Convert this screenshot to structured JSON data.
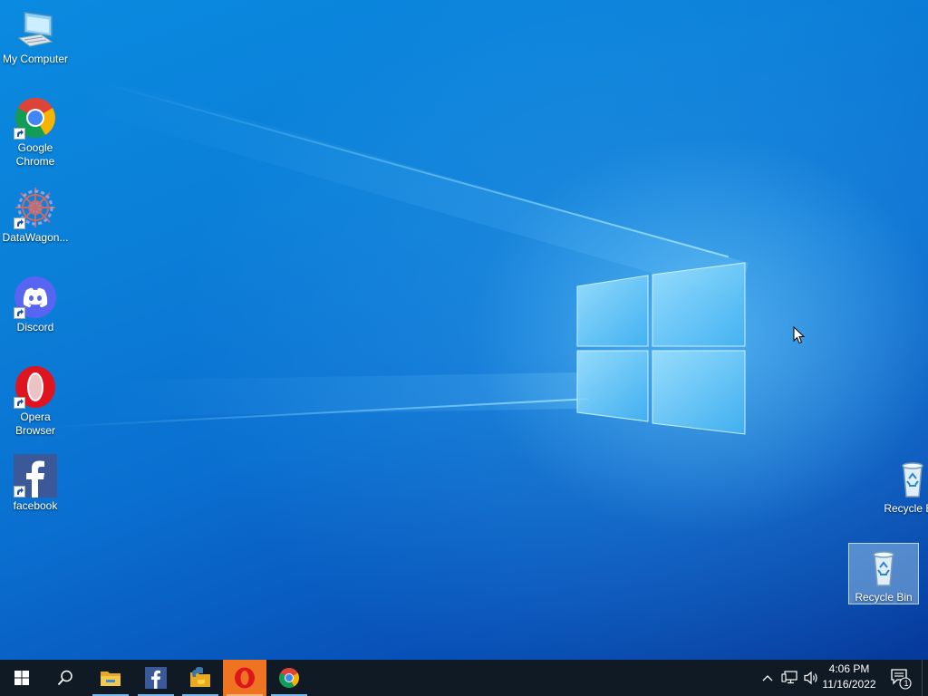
{
  "desktop": {
    "icons": [
      {
        "label": "My Computer",
        "icon": "computer-icon"
      },
      {
        "label": "Google Chrome",
        "icon": "chrome-icon"
      },
      {
        "label": "DataWagon...",
        "icon": "datawagon-icon"
      },
      {
        "label": "Discord",
        "icon": "discord-icon"
      },
      {
        "label": "Opera Browser",
        "icon": "opera-icon"
      },
      {
        "label": "facebook",
        "icon": "facebook-icon"
      },
      {
        "label": "Recycle Bin",
        "icon": "recycle-bin-icon"
      },
      {
        "label": "Recycle Bin",
        "icon": "recycle-bin-icon"
      }
    ]
  },
  "taskbar": {
    "buttons": [
      {
        "name": "start",
        "icon": "windows-logo-icon"
      },
      {
        "name": "search",
        "icon": "search-icon"
      },
      {
        "name": "file-explorer",
        "icon": "folder-icon"
      },
      {
        "name": "facebook",
        "icon": "facebook-icon"
      },
      {
        "name": "python-app",
        "icon": "python-icon"
      },
      {
        "name": "opera",
        "icon": "opera-icon"
      },
      {
        "name": "chrome",
        "icon": "chrome-icon"
      }
    ],
    "tray": {
      "time": "4:06 PM",
      "date": "11/16/2022",
      "notification_count": "1"
    }
  },
  "colors": {
    "accent": "#0b7fd8",
    "taskbar": "#0f1a24",
    "active_button": "#ee7421",
    "running_indicator": "#76b9ed"
  }
}
